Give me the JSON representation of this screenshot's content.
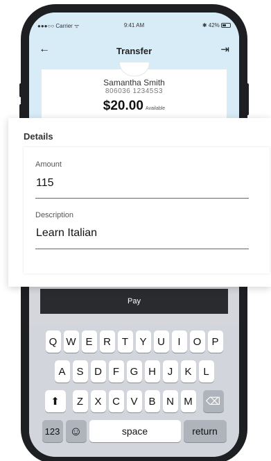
{
  "status_bar": {
    "carrier": "●●●○○ Carrier ᯤ",
    "time": "9:41 AM",
    "battery": "✱ 42%"
  },
  "nav": {
    "back_icon": "←",
    "title": "Transfer",
    "logout_icon": "⇥"
  },
  "recipient": {
    "name": "Samantha Smith",
    "account": "806036 12345S3",
    "balance": "$20.00",
    "balance_note": "Available"
  },
  "details": {
    "heading": "Details",
    "amount_label": "Amount",
    "amount_value": "115",
    "description_label": "Description",
    "description_value": "Learn Italian"
  },
  "pay_button": "Pay",
  "keyboard": {
    "row1": [
      "Q",
      "W",
      "E",
      "R",
      "T",
      "Y",
      "U",
      "I",
      "O",
      "P"
    ],
    "row2": [
      "A",
      "S",
      "D",
      "F",
      "G",
      "H",
      "J",
      "K",
      "L"
    ],
    "row3": [
      "Z",
      "X",
      "C",
      "V",
      "B",
      "N",
      "M"
    ],
    "shift": "⬆",
    "backspace": "⌫",
    "numbers": "123",
    "emoji": "☺",
    "space": "space",
    "return": "return"
  }
}
